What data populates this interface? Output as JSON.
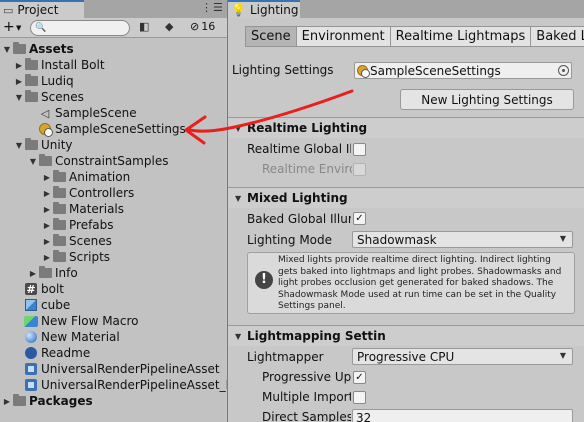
{
  "project": {
    "tab_label": "Project",
    "search_placeholder": "",
    "hidden_count": "16",
    "tree": [
      {
        "label": "Assets",
        "level": 0,
        "arrow": "▼",
        "icon": "folder-icon",
        "bold": true
      },
      {
        "label": "Install Bolt",
        "level": 1,
        "arrow": "▶",
        "icon": "folder-icon"
      },
      {
        "label": "Ludiq",
        "level": 1,
        "arrow": "▶",
        "icon": "folder-icon"
      },
      {
        "label": "Scenes",
        "level": 1,
        "arrow": "▼",
        "icon": "folder-icon"
      },
      {
        "label": "SampleScene",
        "level": 2,
        "arrow": "",
        "icon": "unity-scene-icon"
      },
      {
        "label": "SampleSceneSettings",
        "level": 2,
        "arrow": "",
        "icon": "lighting-settings-icon"
      },
      {
        "label": "Unity",
        "level": 1,
        "arrow": "▼",
        "icon": "folder-icon"
      },
      {
        "label": "ConstraintSamples",
        "level": 2,
        "arrow": "▼",
        "icon": "folder-icon"
      },
      {
        "label": "Animation",
        "level": 3,
        "arrow": "▶",
        "icon": "folder-icon"
      },
      {
        "label": "Controllers",
        "level": 3,
        "arrow": "▶",
        "icon": "folder-icon"
      },
      {
        "label": "Materials",
        "level": 3,
        "arrow": "▶",
        "icon": "folder-icon"
      },
      {
        "label": "Prefabs",
        "level": 3,
        "arrow": "▶",
        "icon": "folder-icon"
      },
      {
        "label": "Scenes",
        "level": 3,
        "arrow": "▶",
        "icon": "folder-icon"
      },
      {
        "label": "Scripts",
        "level": 3,
        "arrow": "▶",
        "icon": "folder-icon"
      },
      {
        "label": "Info",
        "level": 2,
        "arrow": "▶",
        "icon": "folder-icon"
      },
      {
        "label": "bolt",
        "level": 1,
        "arrow": "",
        "icon": "script-hash-icon"
      },
      {
        "label": "cube",
        "level": 1,
        "arrow": "",
        "icon": "prefab-cube-icon"
      },
      {
        "label": "New Flow Macro",
        "level": 1,
        "arrow": "",
        "icon": "flow-macro-icon"
      },
      {
        "label": "New Material",
        "level": 1,
        "arrow": "",
        "icon": "material-icon"
      },
      {
        "label": "Readme",
        "level": 1,
        "arrow": "",
        "icon": "readme-icon"
      },
      {
        "label": "UniversalRenderPipelineAsset",
        "level": 1,
        "arrow": "",
        "icon": "render-pipeline-icon"
      },
      {
        "label": "UniversalRenderPipelineAsset_R",
        "level": 1,
        "arrow": "",
        "icon": "render-pipeline-icon"
      },
      {
        "label": "Packages",
        "level": 0,
        "arrow": "▶",
        "icon": "folder-icon",
        "bold": true
      }
    ]
  },
  "lighting": {
    "tab_label": "Lighting",
    "subtabs": [
      "Scene",
      "Environment",
      "Realtime Lightmaps",
      "Baked Ligh"
    ],
    "settings_label": "Lighting Settings",
    "settings_value": "SampleSceneSettings",
    "new_button": "New Lighting Settings",
    "realtime": {
      "header": "Realtime Lighting",
      "global_label": "Realtime Global Illu",
      "env_label": "Realtime Environ"
    },
    "mixed": {
      "header": "Mixed Lighting",
      "baked_label": "Baked Global Illum",
      "baked_checked": "✓",
      "mode_label": "Lighting Mode",
      "mode_value": "Shadowmask",
      "help_text": "Mixed lights provide realtime direct lighting. Indirect lighting gets baked into lightmaps and light probes. Shadowmasks and light probes occlusion get generated for baked shadows. The Shadowmask Mode used at run time can be set in the Quality Settings panel."
    },
    "lightmapping": {
      "header": "Lightmapping Settin",
      "lightmapper_label": "Lightmapper",
      "lightmapper_value": "Progressive CPU",
      "progressive_label": "Progressive Upc",
      "progressive_checked": "✓",
      "multiple_label": "Multiple Importa",
      "direct_label": "Direct Samples",
      "direct_value": "32"
    }
  },
  "colors": {
    "annotation": "#e8201c",
    "tab_accent": "#3a72b0"
  }
}
